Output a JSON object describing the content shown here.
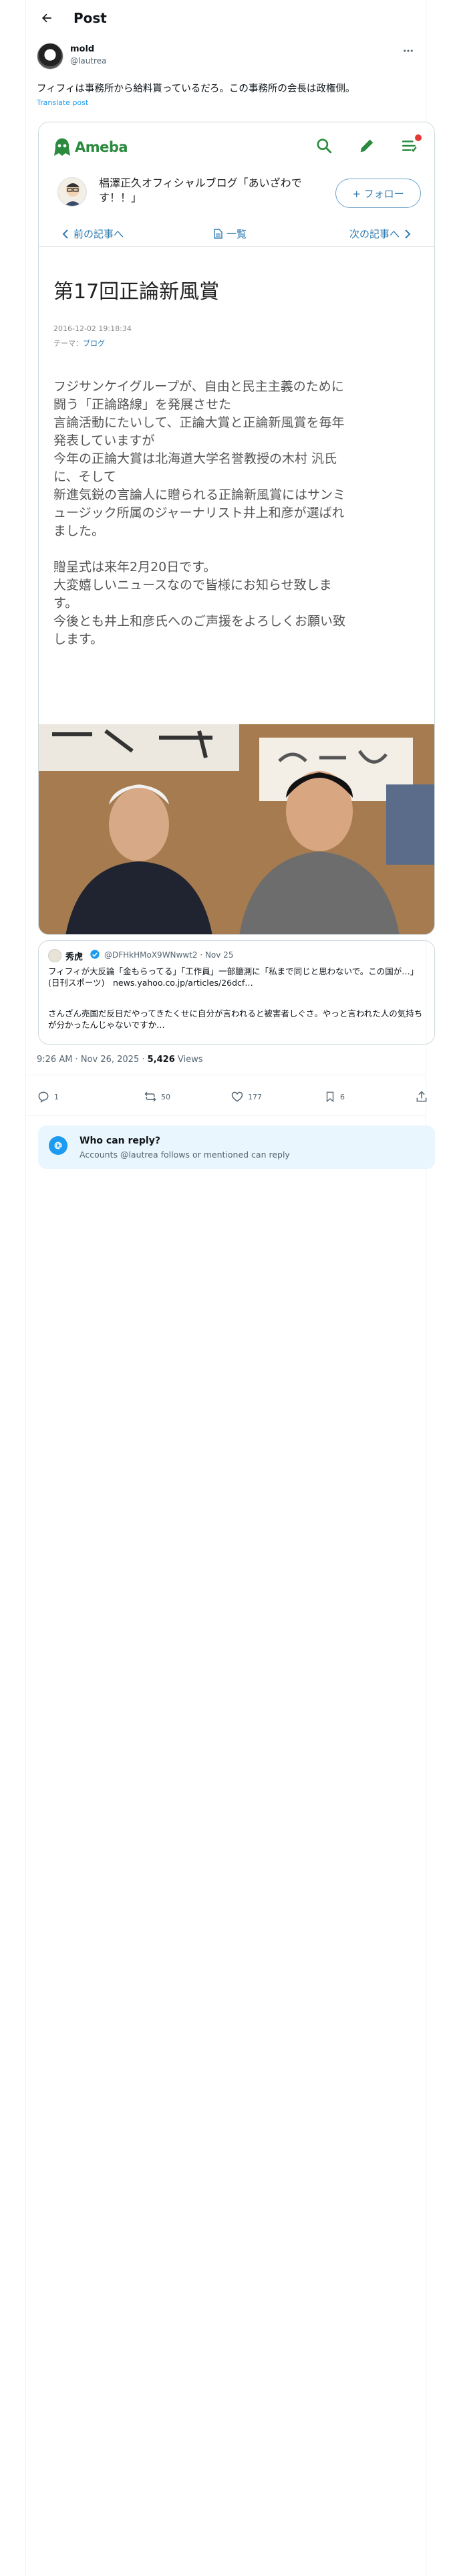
{
  "header": {
    "title": "Post"
  },
  "post": {
    "author_name": "mold",
    "author_handle": "@lautrea",
    "text": "フィフィは事務所から給料貰っているだろ。この事務所の会長は政権側。",
    "translate_label": "Translate post",
    "timestamp": "9:26 AM · Nov 26, 2025 · ",
    "views_count": "5,426",
    "views_label": " Views"
  },
  "ameba": {
    "logo": "Ameba",
    "blog_title": "椙澤正久オフィシャルブログ「あいざわです！！」",
    "follow_label": "+ フォロー",
    "nav_prev": "前の記事へ",
    "nav_list": "一覧",
    "nav_next": "次の記事へ",
    "article_title": "第17回正論新風賞",
    "date": "2016-12-02 19:18:34",
    "theme_label": "テーマ：",
    "theme_value": "ブログ",
    "body_p1": "フジサンケイグループが、自由と民主主義のために\n闘う「正論路線」を発展させた\n言論活動にたいして、正論大賞と正論新風賞を毎年\n発表していますが\n今年の正論大賞は北海道大学名誉教授の木村 汎氏\nに、そして\n新進気鋭の言論人に贈られる正論新風賞にはサンミ\nュージック所属のジャーナリスト井上和彦が選ばれ\nました。",
    "body_p2": "贈呈式は来年2月20日です。\n大変嬉しいニュースなので皆様にお知らせ致しま\nす。\n今後とも井上和彦氏へのご声援をよろしくお願い致\nします。"
  },
  "quote": {
    "name": "秀虎",
    "handle": "@DFHkHMoX9WNwwt2 · Nov 25",
    "text1": "フィフィが大反論「金もらってる」「工作員」一部臆測に「私まで同じと思わないで。この国が…」(日刊スポーツ)　news.yahoo.co.jp/articles/26dcf…",
    "text2": "さんざん売国だ反日だやってきたくせに自分が言われると被害者しぐさ。やっと言われた人の気持ちが分かったんじゃないですか…"
  },
  "actions": {
    "replies": "1",
    "reposts": "50",
    "likes": "177",
    "bookmarks": "6"
  },
  "reply_notice": {
    "title": "Who can reply?",
    "subtitle": "Accounts @lautrea follows or mentioned can reply"
  },
  "colors": {
    "accent": "#1d9bf0",
    "ameba_green": "#2b8a3e",
    "ameba_link": "#2f7ab1"
  }
}
